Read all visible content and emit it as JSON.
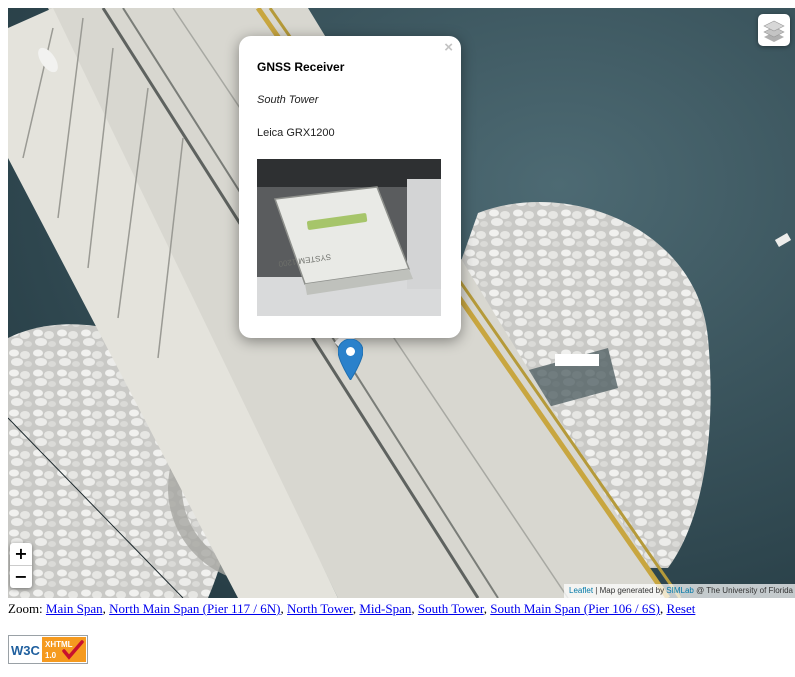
{
  "map": {
    "layers_control_icon": "layers-icon",
    "zoom_in_label": "+",
    "zoom_out_label": "−",
    "marker_icon": "map-pin-icon",
    "marker_color": "#2a81cb",
    "attribution": {
      "leaflet_label": "Leaflet",
      "separator": " | ",
      "generated_prefix": "Map generated by ",
      "lab_label": "SIMLab",
      "suffix": " @ The University of Florida"
    }
  },
  "popup": {
    "close_label": "×",
    "title": "GNSS Receiver",
    "location": "South Tower",
    "model": "Leica GRX1200",
    "photo_caption": "SYSTEM 1200"
  },
  "zoom_nav": {
    "prefix": "Zoom: ",
    "links": [
      "Main Span",
      "North Main Span (Pier 117 / 6N)",
      "North Tower",
      "Mid-Span",
      "South Tower",
      "South Main Span (Pier 106 / 6S)",
      "Reset"
    ]
  },
  "validator_badge": {
    "w3c_label": "W3C",
    "xhtml_label": "XHTML",
    "version_label": "1.0",
    "icon": "checkmark-icon"
  }
}
